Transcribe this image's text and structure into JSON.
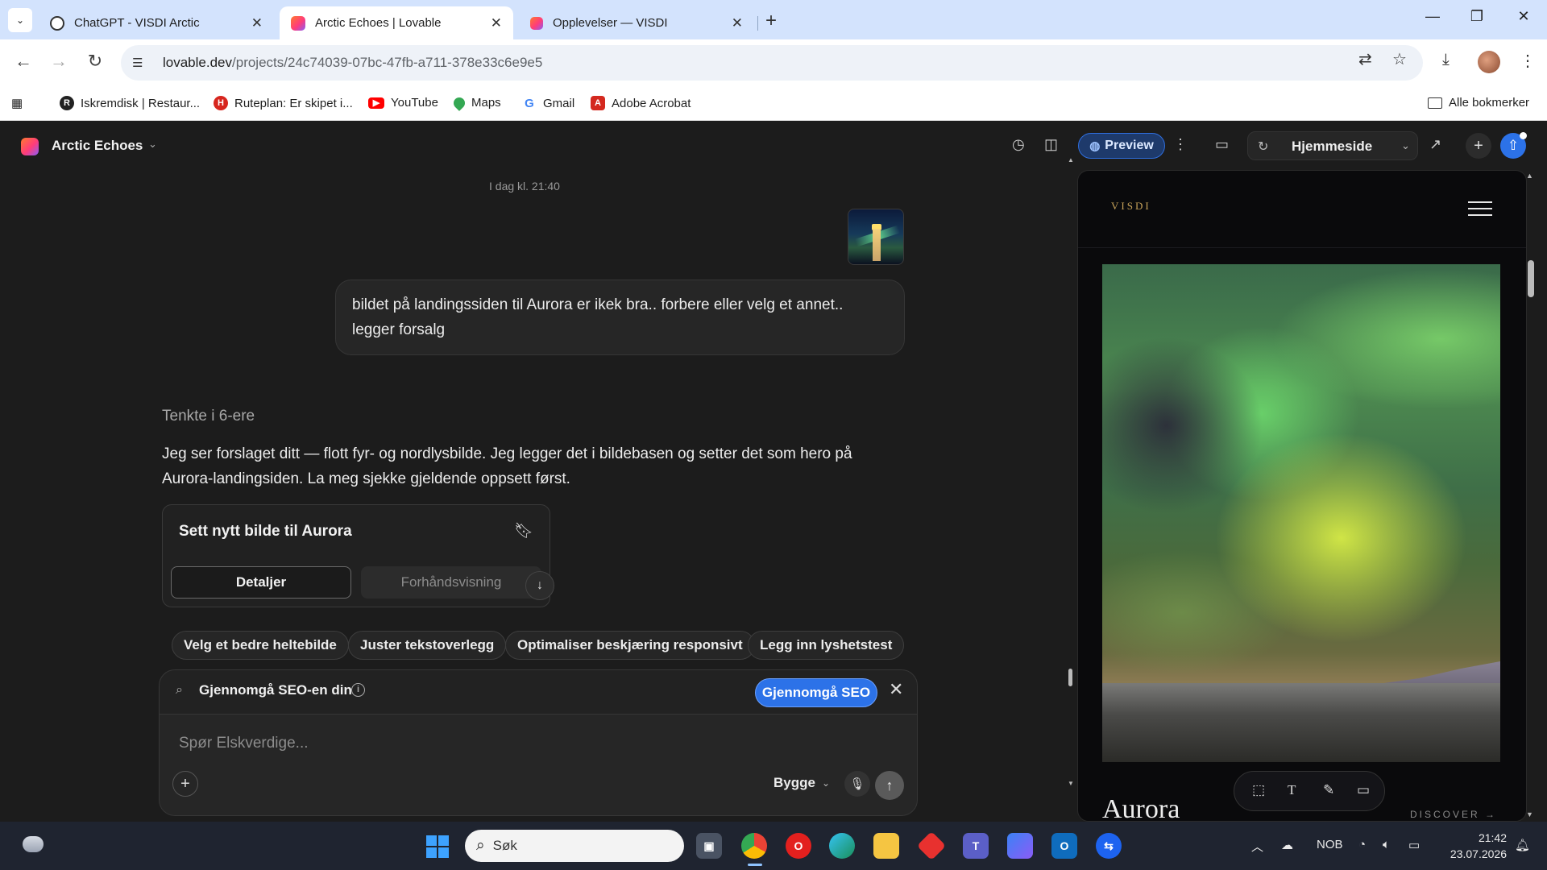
{
  "browser": {
    "tabs": [
      {
        "title": "ChatGPT - VISDI Arctic",
        "icon": "chatgpt-icon",
        "active": false
      },
      {
        "title": "Arctic Echoes | Lovable",
        "icon": "lovable-icon",
        "active": true
      },
      {
        "title": "Opplevelser — VISDI",
        "icon": "lovable-icon",
        "active": false
      }
    ],
    "url_host": "lovable.dev",
    "url_path": "/projects/24c74039-07bc-47fb-a711-378e33c6e9e5",
    "bookmarks": [
      {
        "label": "Iskremdisk | Restaur...",
        "icon": "rs-icon",
        "color": "#222222"
      },
      {
        "label": "Ruteplan: Er skipet i...",
        "icon": "hurtigruten-icon",
        "color": "#d7261e"
      },
      {
        "label": "YouTube",
        "icon": "youtube-icon",
        "color": "#ff0000"
      },
      {
        "label": "Maps",
        "icon": "maps-icon",
        "color": "#34a853"
      },
      {
        "label": "Gmail",
        "icon": "google-icon",
        "color": "#4285f4"
      },
      {
        "label": "Adobe Acrobat",
        "icon": "acrobat-icon",
        "color": "#d4291f"
      }
    ],
    "all_bookmarks": "Alle bokmerker"
  },
  "app": {
    "project_name": "Arctic Echoes",
    "preview_label": "Preview",
    "route_label": "Hjemmeside",
    "accent": "#2c72e8"
  },
  "chat": {
    "timestamp": "I dag kl. 21:40",
    "user_message": "bildet på landingssiden til Aurora er ikek bra.. forbere eller velg et annet.. legger forsalg",
    "thought": "Tenkte i 6-ere",
    "assistant_message": "Jeg ser forslaget ditt — flott fyr- og nordlysbilde. Jeg legger det i bildebasen og setter det som hero på Aurora-landingsiden. La meg sjekke gjeldende oppsett først.",
    "card": {
      "title": "Sett nytt bilde til Aurora",
      "tab_details": "Detaljer",
      "tab_preview": "Forhåndsvisning"
    },
    "suggestions": [
      "Velg et bedre heltebilde",
      "Juster tekstoverlegg",
      "Optimaliser beskjæring responsivt",
      "Legg inn lyshetstest"
    ]
  },
  "composer": {
    "seo_text": "Gjennomgå SEO-en din",
    "seo_button": "Gjennomgå SEO",
    "placeholder": "Spør Elskverdige...",
    "mode": "Bygge"
  },
  "preview": {
    "logo": "VISDI",
    "hero_title": "Aurora",
    "discover": "DISCOVER →"
  },
  "taskbar": {
    "search_placeholder": "Søk",
    "language": "NOB",
    "time": "21:42",
    "date": "23.07.2026"
  }
}
